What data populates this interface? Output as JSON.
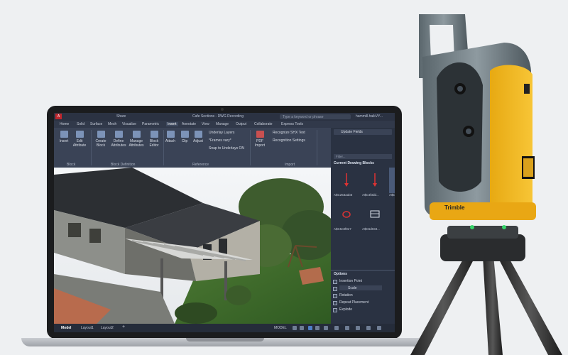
{
  "app": {
    "title": "Cafe Sections - DWG Recording",
    "share_label": "Share",
    "search_placeholder": "Type a keyword or phrase",
    "user": "hammill.haikVY..."
  },
  "ribbon_tabs": [
    "Home",
    "Solid",
    "Surface",
    "Mesh",
    "Visualize",
    "Parametric",
    "Insert",
    "Annotate",
    "View",
    "Manage",
    "Output",
    "Collaborate",
    "Express Tools"
  ],
  "active_tab": "Insert",
  "ribbon": {
    "block": {
      "insert": "Insert",
      "edit_attribute": "Edit Attribute",
      "group": "Block"
    },
    "block_definition": {
      "create_block": "Create Block",
      "define_attributes": "Define Attributes",
      "manage_attributes": "Manage Attributes",
      "block_editor": "Block Editor",
      "group": "Block Definition"
    },
    "reference": {
      "attach": "Attach",
      "clip": "Clip",
      "adjust": "Adjust",
      "underlay_layers": "Underlay Layers",
      "frames_vary": "*Frames vary*",
      "snap_to_underlays": "Snap to Underlays ON",
      "group": "Reference"
    },
    "import": {
      "pdf_import": "PDF Import",
      "recognize_shx": "Recognize SHX Text",
      "recognition_settings": "Recognition Settings",
      "group": "Import"
    },
    "data": {
      "update_fields": "Update Fields"
    }
  },
  "blocks_panel": {
    "filter_placeholder": "Filter...",
    "title": "Current Drawing Blocks",
    "items": [
      {
        "label": "A$C253aab6",
        "icon": "red-arrow-icon"
      },
      {
        "label": "A$C4f3dd...",
        "icon": "red-arrow-icon"
      },
      {
        "label": "A$C...",
        "icon": "block-icon"
      },
      {
        "label": "A$C5c8f8e7",
        "icon": "red-circle-icon"
      },
      {
        "label": "A$C6d034...",
        "icon": "table-block-icon"
      }
    ],
    "options_title": "Options",
    "options": [
      "Insertion Point",
      "Scale",
      "Rotation",
      "Repeat Placement",
      "Explode"
    ],
    "scale_value": "Scale"
  },
  "status_bar": {
    "tabs": [
      "Model",
      "Layout1",
      "Layout2"
    ],
    "add_label": "+",
    "model_label": "MODEL"
  },
  "device": {
    "brand": "Trimble"
  },
  "colors": {
    "accent_yellow": "#f2b51d",
    "autocad_red": "#c0272d",
    "ui_dark": "#2a3242"
  }
}
